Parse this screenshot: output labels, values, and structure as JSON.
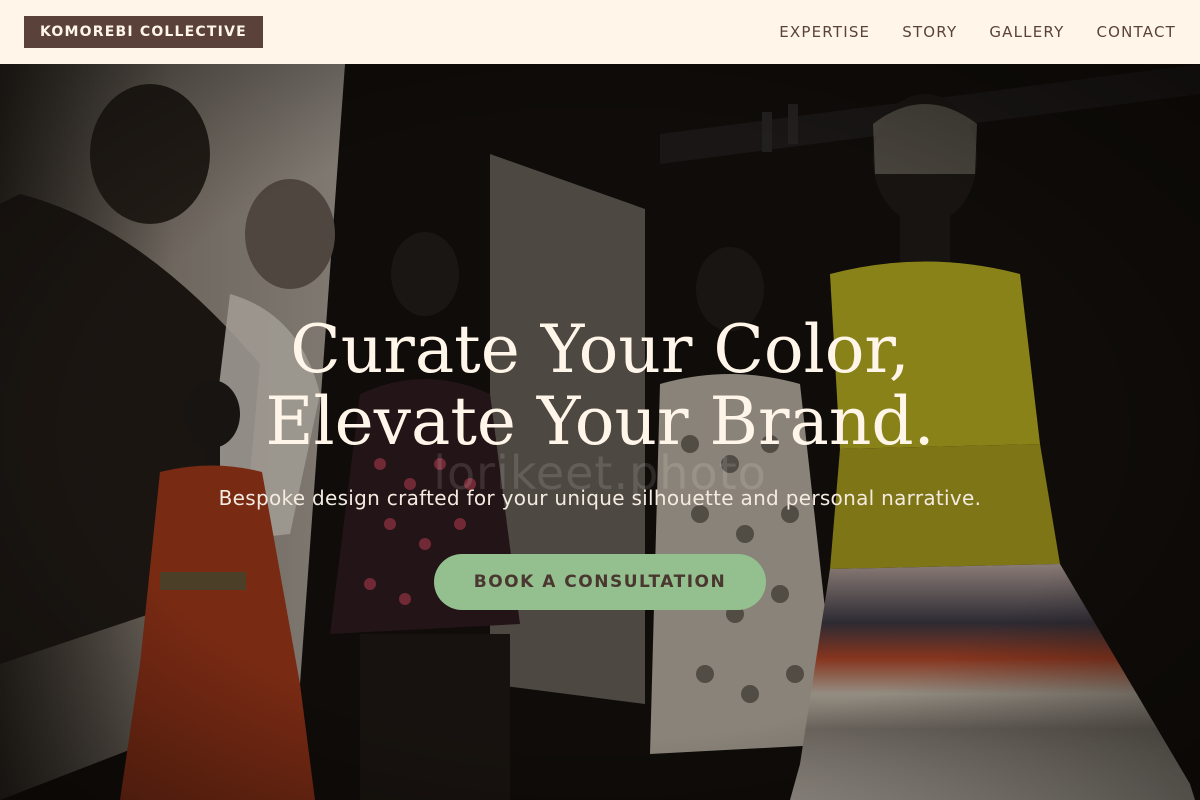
{
  "brand": {
    "logo": "KOMOREBI COLLECTIVE"
  },
  "nav": {
    "items": [
      {
        "label": "EXPERTISE"
      },
      {
        "label": "STORY"
      },
      {
        "label": "GALLERY"
      },
      {
        "label": "CONTACT"
      }
    ]
  },
  "hero": {
    "headline_line1": "Curate Your Color,",
    "headline_line2": "Elevate Your Brand.",
    "subtitle": "Bespoke design crafted for your unique silhouette and personal narrative.",
    "cta_label": "BOOK A CONSULTATION",
    "watermark": "lorikeet.photo"
  },
  "colors": {
    "header_bg": "#fff6e9",
    "brand_accent": "#5a423a",
    "cta_bg": "#93c08e",
    "headline_text": "#fff6e9"
  }
}
